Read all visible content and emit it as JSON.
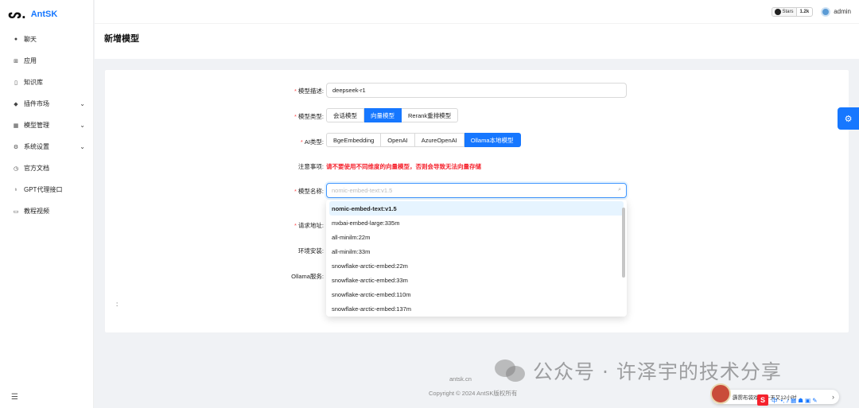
{
  "app": {
    "logo_mark": "ᔕ.",
    "name": "AntSK"
  },
  "sidebar": {
    "items": [
      {
        "icon": "chat-icon",
        "glyph": "●",
        "label": "聊天",
        "has_sub": false
      },
      {
        "icon": "apps-icon",
        "glyph": "⊞",
        "label": "应用",
        "has_sub": false
      },
      {
        "icon": "book-icon",
        "glyph": "▯",
        "label": "知识库",
        "has_sub": false
      },
      {
        "icon": "plugin-icon",
        "glyph": "◆",
        "label": "插件市场",
        "has_sub": true
      },
      {
        "icon": "model-icon",
        "glyph": "▦",
        "label": "模型管理",
        "has_sub": true
      },
      {
        "icon": "gear-icon",
        "glyph": "⚙",
        "label": "系统设置",
        "has_sub": true
      },
      {
        "icon": "docs-icon",
        "glyph": "◷",
        "label": "官方文档",
        "has_sub": false
      },
      {
        "icon": "bulb-icon",
        "glyph": "♁",
        "label": "GPT代理接口",
        "has_sub": false
      },
      {
        "icon": "video-icon",
        "glyph": "▭",
        "label": "教程视频",
        "has_sub": false
      }
    ],
    "collapse_glyph": "☰"
  },
  "header": {
    "github": {
      "label": "Stars",
      "count": "1.2k"
    },
    "user": "admin"
  },
  "page": {
    "title": "新增模型"
  },
  "form": {
    "desc_label": "模型描述:",
    "desc_value": "deepseek-r1",
    "type_label": "模型类型:",
    "types": [
      {
        "label": "会话模型",
        "active": false
      },
      {
        "label": "向量模型",
        "active": true
      },
      {
        "label": "Rerank重排模型",
        "active": false
      }
    ],
    "ai_label": "AI类型:",
    "ai_types": [
      {
        "label": "BgeEmbedding",
        "active": false
      },
      {
        "label": "OpenAI",
        "active": false
      },
      {
        "label": "AzureOpenAI",
        "active": false
      },
      {
        "label": "Ollama本地模型",
        "active": true
      }
    ],
    "note_label": "注意事项:",
    "note_text": "请不要使用不同维度的向量模型，否则会导致无法向量存储",
    "name_label": "模型名称:",
    "name_placeholder": "nomic-embed-text:v1.5",
    "url_label": "请求地址:",
    "env_label": "环境安装:",
    "ollama_label": "Ollama服务:",
    "colon_mark": ":"
  },
  "dropdown": {
    "options": [
      {
        "label": "nomic-embed-text:v1.5",
        "active": true
      },
      {
        "label": "mxbai-embed-large:335m",
        "active": false
      },
      {
        "label": "all-minilm:22m",
        "active": false
      },
      {
        "label": "all-minilm:33m",
        "active": false
      },
      {
        "label": "snowflake-arctic-embed:22m",
        "active": false
      },
      {
        "label": "snowflake-arctic-embed:33m",
        "active": false
      },
      {
        "label": "snowflake-arctic-embed:110m",
        "active": false
      },
      {
        "label": "snowflake-arctic-embed:137m",
        "active": false
      }
    ]
  },
  "footer": {
    "site": "antsk.cn",
    "copyright": "Copyright © 2024 AntSK版权所有"
  },
  "watermark": {
    "text": "公众号 · 许泽宇的技术分享"
  },
  "music": {
    "text": "霹雳布袋戏之 一天又12小时"
  },
  "ime": {
    "logo": "S",
    "lang": "中",
    "glyphs": "•, ♪ ▦ ☗ ▣ ✎"
  },
  "colors": {
    "accent": "#1677ff",
    "warn": "#f5222d"
  }
}
